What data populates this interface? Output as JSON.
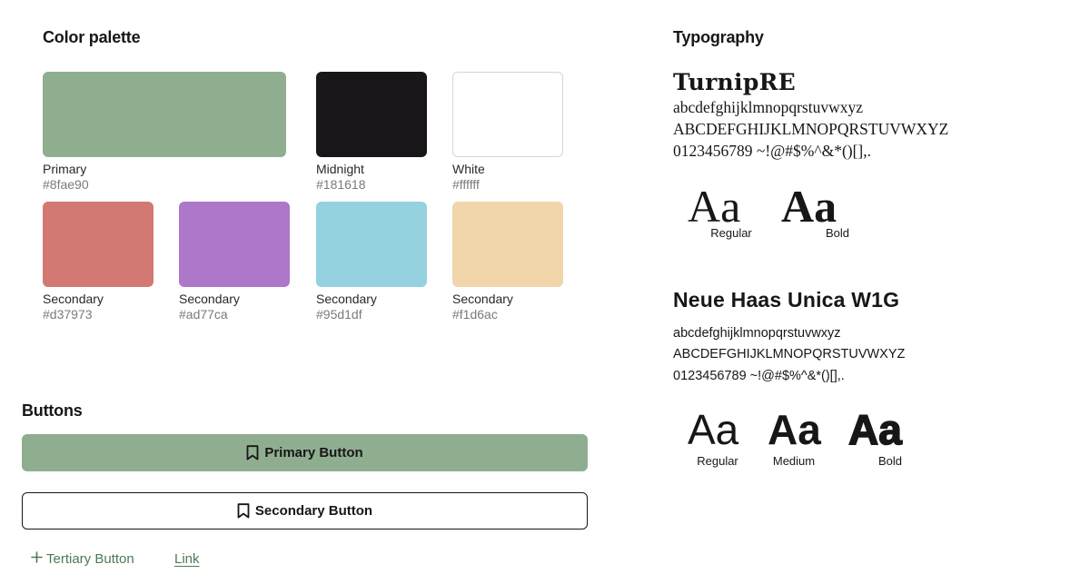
{
  "color_palette": {
    "title": "Color palette",
    "swatches": [
      {
        "name": "Primary",
        "hex": "#8fae90"
      },
      {
        "name": "Midnight",
        "hex": "#181618"
      },
      {
        "name": "White",
        "hex": "#ffffff"
      },
      {
        "name": "Secondary",
        "hex": "#d37973"
      },
      {
        "name": "Secondary",
        "hex": "#ad77ca"
      },
      {
        "name": "Secondary",
        "hex": "#95d1df"
      },
      {
        "name": "Secondary",
        "hex": "#f1d6ac"
      }
    ]
  },
  "buttons": {
    "title": "Buttons",
    "primary_label": "Primary Button",
    "secondary_label": "Secondary Button",
    "tertiary_label": "Tertiary Button",
    "link_label": "Link",
    "primary_icon": "bookmark-icon",
    "secondary_icon": "bookmark-icon",
    "tertiary_icon": "plus-icon",
    "primary_color": "#8fae90",
    "link_color": "#4f7a55"
  },
  "typography": {
    "title": "Typography",
    "serif": {
      "name": "TurnipRE",
      "lowercase": "abcdefghijklmnopqrstuvwxyz",
      "uppercase": "ABCDEFGHIJKLMNOPQRSTUVWXYZ",
      "digits": "0123456789 ~!@#$%^&*()[],.",
      "sample": "Aa",
      "weights": [
        "Regular",
        "Bold"
      ]
    },
    "sans": {
      "name": "Neue Haas Unica W1G",
      "lowercase": "abcdefghijklmnopqrstuvwxyz",
      "uppercase": "ABCDEFGHIJKLMNOPQRSTUVWXYZ",
      "digits": "0123456789 ~!@#$%^&*()[],.",
      "sample": "Aa",
      "weights": [
        "Regular",
        "Medium",
        "Bold"
      ]
    }
  }
}
